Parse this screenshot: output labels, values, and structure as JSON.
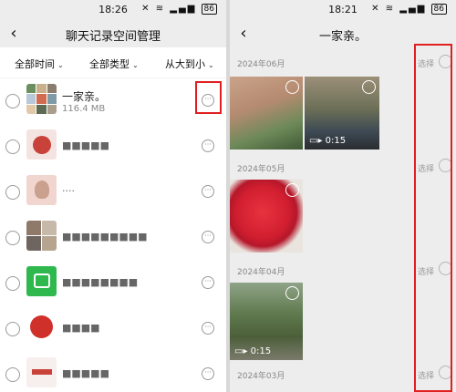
{
  "left": {
    "status_time": "18:26",
    "battery": "86",
    "title": "聊天记录空间管理",
    "filters": [
      "全部时间",
      "全部类型",
      "从大到小"
    ],
    "chats": [
      {
        "name": "一家亲。",
        "size": "116.4 MB"
      },
      {
        "name": "■■■■■",
        "size": ""
      },
      {
        "name": "····",
        "size": ""
      },
      {
        "name": "■■■■■■■■■",
        "size": ""
      },
      {
        "name": "■■■■■■■■",
        "size": ""
      },
      {
        "name": "■■■■",
        "size": ""
      },
      {
        "name": "■■■■■",
        "size": ""
      }
    ]
  },
  "right": {
    "status_time": "18:21",
    "battery": "86",
    "title": "一家亲。",
    "select_label": "选择",
    "groups": [
      {
        "date": "2024年06月"
      },
      {
        "date": "2024年05月"
      },
      {
        "date": "2024年04月"
      },
      {
        "date": "2024年03月"
      }
    ],
    "video_durations": [
      "0:15",
      "0:15"
    ]
  },
  "icons": {
    "back": "chevron-left-icon",
    "more": "more-horizontal-icon",
    "video": "video-camera-icon",
    "wifi": "wifi-icon"
  },
  "colors": {
    "highlight": "#e02020",
    "nav_bg": "#ededed"
  }
}
